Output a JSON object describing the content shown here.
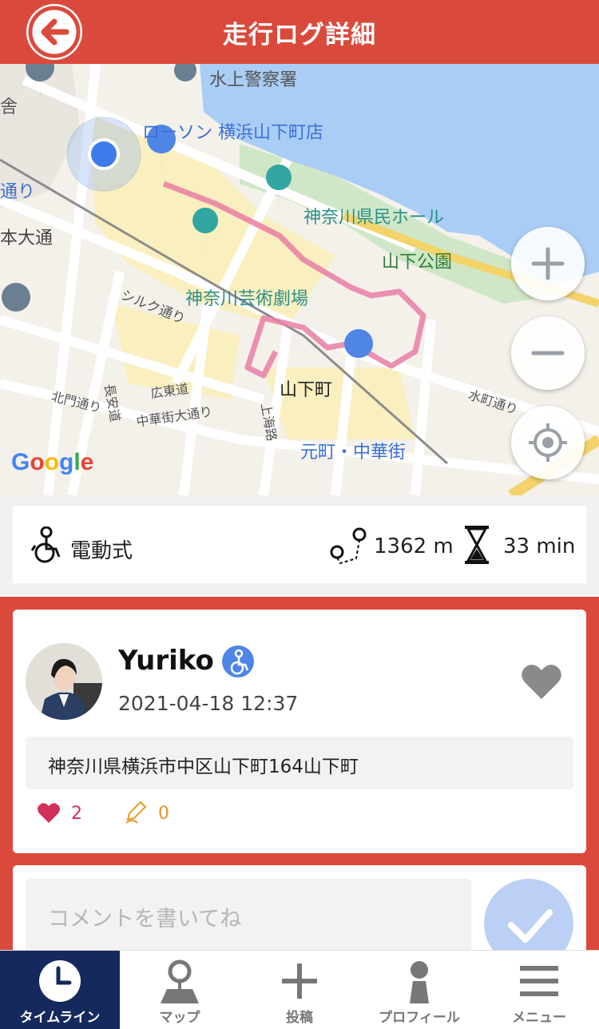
{
  "header": {
    "title": "走行ログ詳細"
  },
  "map": {
    "labels": {
      "police": "水上警察署",
      "lawson": "ローソン 横浜山下町店",
      "hall": "神奈川県民ホール",
      "park": "山下公園",
      "theater": "神奈川芸術劇場",
      "silk": "シルク通り",
      "yamashita": "山下町",
      "motomachi": "元町・中華街",
      "hirohigashi": "広東道",
      "chukagai": "中華街大通り",
      "kitamon": "北門通り",
      "choan": "長安道",
      "shanghai": "上海路",
      "suicho": "水町通り",
      "hondori": "本大通",
      "dori": "通り",
      "nihon": "日本",
      "sha": "舎"
    },
    "google": "Google",
    "route_color": "#e87ea5",
    "zoom_in_icon": "plus-icon",
    "zoom_out_icon": "minus-icon",
    "locate_icon": "crosshair-icon"
  },
  "stats": {
    "mode": "電動式",
    "distance": "1362 m",
    "duration": "33 min"
  },
  "post": {
    "username": "Yuriko",
    "timestamp": "2021-04-18 12:37",
    "address": "神奈川県横浜市中区山下町164山下町",
    "likes": "2",
    "comments": "0",
    "like_color": "#d0305a",
    "comment_color": "#e39a27"
  },
  "comment": {
    "placeholder": "コメントを書いてね"
  },
  "tabs": [
    {
      "label": "タイムライン",
      "icon": "clock-icon",
      "active": true
    },
    {
      "label": "マップ",
      "icon": "map-pin-icon",
      "active": false
    },
    {
      "label": "投稿",
      "icon": "plus-icon",
      "active": false
    },
    {
      "label": "プロフィール",
      "icon": "person-icon",
      "active": false
    },
    {
      "label": "メニュー",
      "icon": "menu-icon",
      "active": false
    }
  ],
  "colors": {
    "accent": "#da4a3c",
    "tab_active": "#15295c",
    "badge": "#4f86e6"
  }
}
